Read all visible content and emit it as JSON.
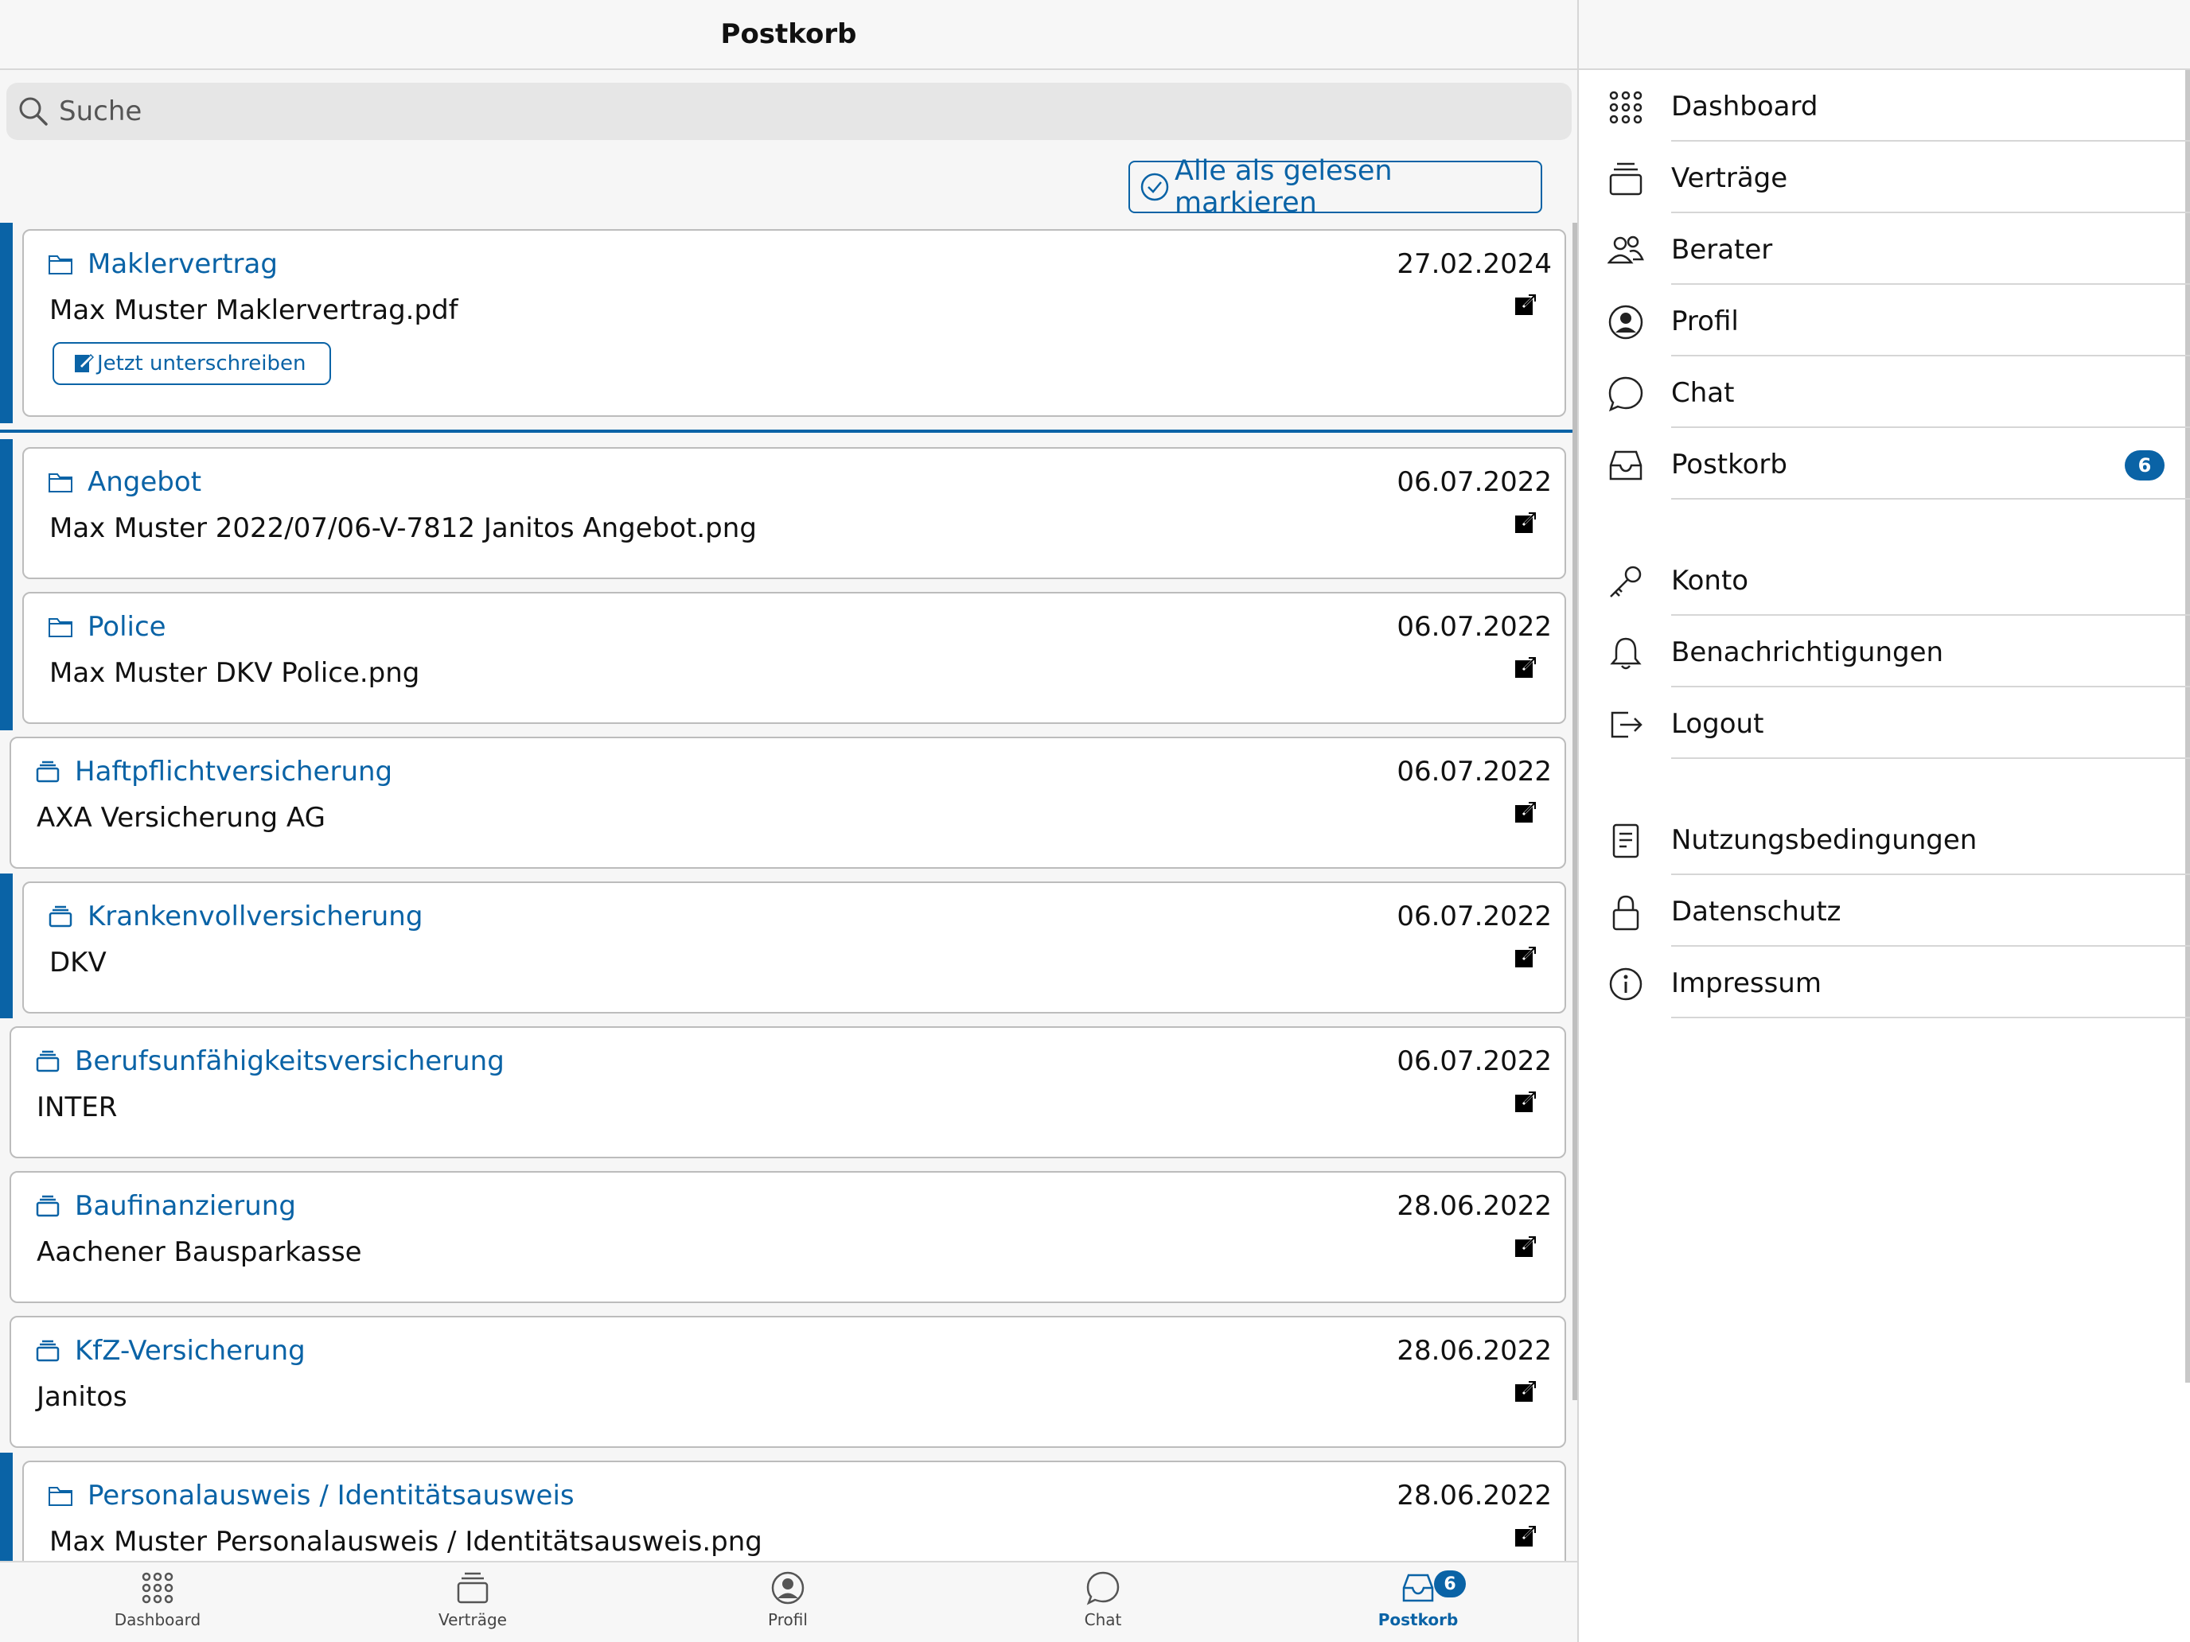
{
  "header": {
    "title": "Postkorb"
  },
  "search": {
    "placeholder": "Suche"
  },
  "actions": {
    "mark_all_read": "Alle als gelesen markieren"
  },
  "accent_color": "#0a63a6",
  "items": [
    {
      "category": "Maklervertrag",
      "icon": "folder-icon",
      "subtitle": "Max Muster Maklervertrag.pdf",
      "date": "27.02.2024",
      "unread": true,
      "action": "Jetzt unterschreiben"
    },
    {
      "category": "Angebot",
      "icon": "folder-icon",
      "subtitle": "Max Muster 2022/07/06-V-7812 Janitos Angebot.png",
      "date": "06.07.2022",
      "unread": true
    },
    {
      "category": "Police",
      "icon": "folder-icon",
      "subtitle": "Max Muster DKV Police.png",
      "date": "06.07.2022",
      "unread": true
    },
    {
      "category": "Haftpflichtversicherung",
      "icon": "contract-stack-icon",
      "subtitle": "AXA Versicherung AG",
      "date": "06.07.2022",
      "unread": false
    },
    {
      "category": "Krankenvollversicherung",
      "icon": "contract-stack-icon",
      "subtitle": "DKV",
      "date": "06.07.2022",
      "unread": true
    },
    {
      "category": "Berufsunfähigkeitsversicherung",
      "icon": "contract-stack-icon",
      "subtitle": "INTER",
      "date": "06.07.2022",
      "unread": false
    },
    {
      "category": "Baufinanzierung",
      "icon": "contract-stack-icon",
      "subtitle": "Aachener Bausparkasse",
      "date": "28.06.2022",
      "unread": false
    },
    {
      "category": "KfZ-Versicherung",
      "icon": "contract-stack-icon",
      "subtitle": "Janitos",
      "date": "28.06.2022",
      "unread": false
    },
    {
      "category": "Personalausweis / Identitätsausweis",
      "icon": "folder-icon",
      "subtitle": "Max Muster Personalausweis / Identitätsausweis.png",
      "date": "28.06.2022",
      "unread": true
    }
  ],
  "bottom_nav": [
    {
      "label": "Dashboard",
      "icon": "grid-icon"
    },
    {
      "label": "Verträge",
      "icon": "contract-stack-icon"
    },
    {
      "label": "Profil",
      "icon": "profile-icon"
    },
    {
      "label": "Chat",
      "icon": "chat-icon"
    },
    {
      "label": "Postkorb",
      "icon": "inbox-icon",
      "badge": "6",
      "active": true
    }
  ],
  "side_menu": {
    "main": [
      {
        "label": "Dashboard",
        "icon": "grid-icon"
      },
      {
        "label": "Verträge",
        "icon": "contract-stack-icon"
      },
      {
        "label": "Berater",
        "icon": "people-icon"
      },
      {
        "label": "Profil",
        "icon": "profile-icon"
      },
      {
        "label": "Chat",
        "icon": "chat-icon"
      },
      {
        "label": "Postkorb",
        "icon": "inbox-icon",
        "badge": "6"
      }
    ],
    "account": [
      {
        "label": "Konto",
        "icon": "key-icon"
      },
      {
        "label": "Benachrichtigungen",
        "icon": "bell-icon"
      },
      {
        "label": "Logout",
        "icon": "logout-icon"
      }
    ],
    "legal": [
      {
        "label": "Nutzungsbedingungen",
        "icon": "document-icon"
      },
      {
        "label": "Datenschutz",
        "icon": "lock-icon"
      },
      {
        "label": "Impressum",
        "icon": "info-icon"
      }
    ]
  }
}
